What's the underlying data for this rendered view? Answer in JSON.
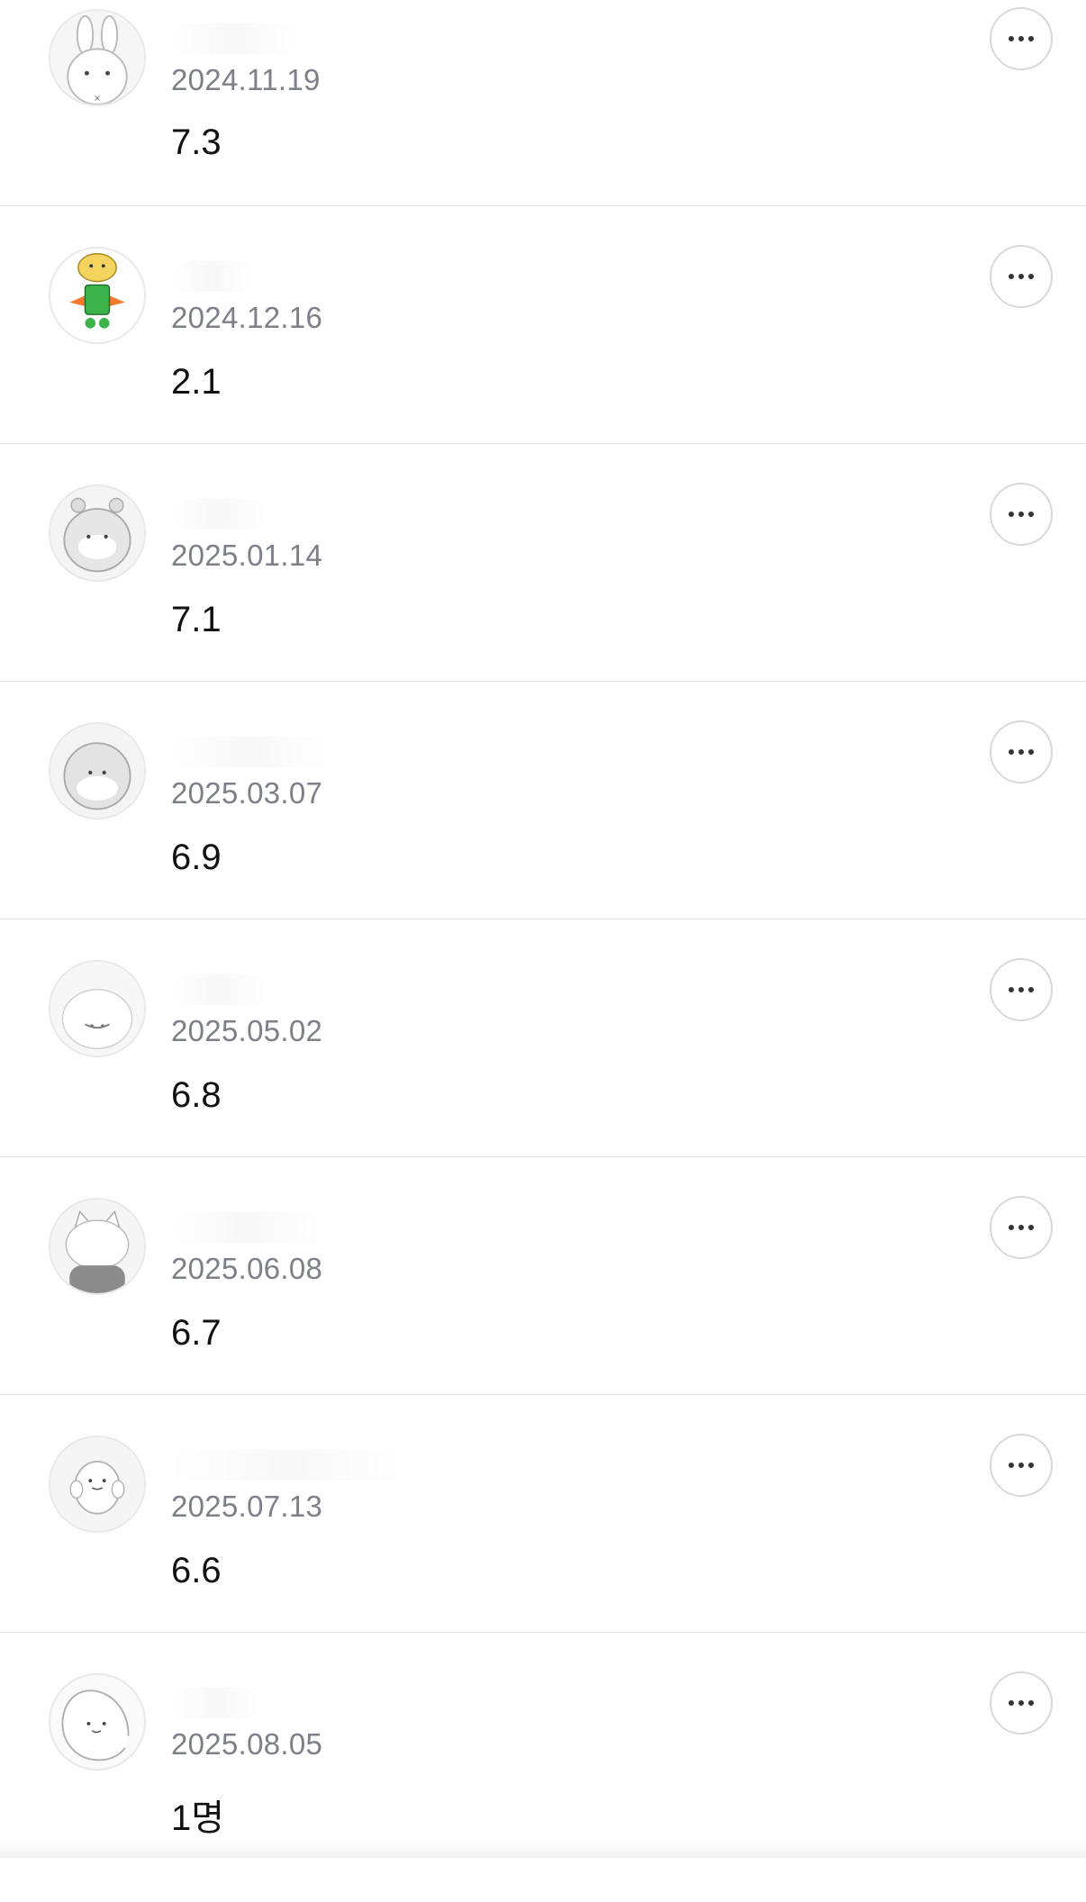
{
  "feed": {
    "items": [
      {
        "date": "2024.11.19",
        "value": "7.3",
        "avatar": "rabbit-avatar"
      },
      {
        "date": "2024.12.16",
        "value": "2.1",
        "avatar": "character-avatar"
      },
      {
        "date": "2025.01.14",
        "value": "7.1",
        "avatar": "hamster-avatar"
      },
      {
        "date": "2025.03.07",
        "value": "6.9",
        "avatar": "hamster-avatar"
      },
      {
        "date": "2025.05.02",
        "value": "6.8",
        "avatar": "hamster-avatar"
      },
      {
        "date": "2025.06.08",
        "value": "6.7",
        "avatar": "cat-avatar"
      },
      {
        "date": "2025.07.13",
        "value": "6.6",
        "avatar": "bear-avatar"
      },
      {
        "date": "2025.08.05",
        "value": "1명",
        "avatar": "seal-avatar"
      }
    ],
    "more_icon": "more-dots-icon"
  }
}
